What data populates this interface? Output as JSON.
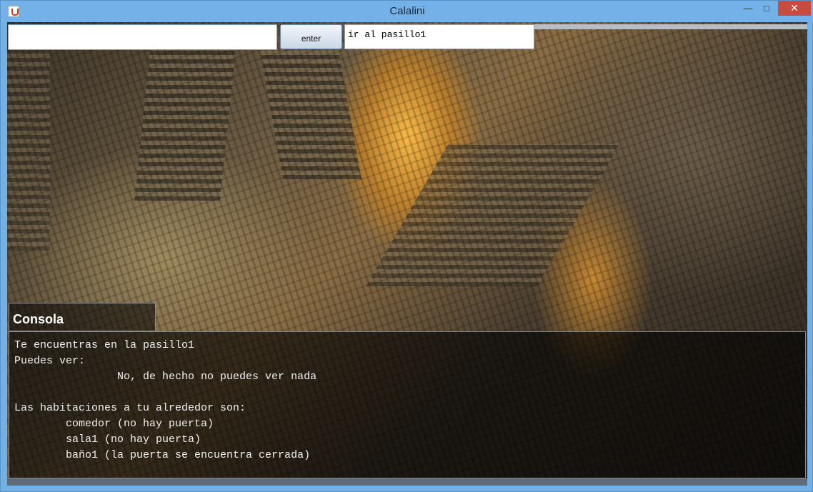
{
  "window": {
    "title": "Calalini",
    "minimize_glyph": "—",
    "maximize_glyph": "□",
    "close_glyph": "✕"
  },
  "controls": {
    "command_input_value": "",
    "enter_label": "enter",
    "last_command": "ir al pasillo1"
  },
  "console": {
    "label": "Consola",
    "lines": [
      "Te encuentras en la pasillo1",
      "Puedes ver:",
      "                No, de hecho no puedes ver nada",
      "",
      "Las habitaciones a tu alrededor son:",
      "        comedor (no hay puerta)",
      "        sala1 (no hay puerta)",
      "        baño1 (la puerta se encuentra cerrada)"
    ]
  },
  "icons": [
    "java-app-icon",
    "minimize-icon",
    "maximize-icon",
    "close-icon"
  ]
}
